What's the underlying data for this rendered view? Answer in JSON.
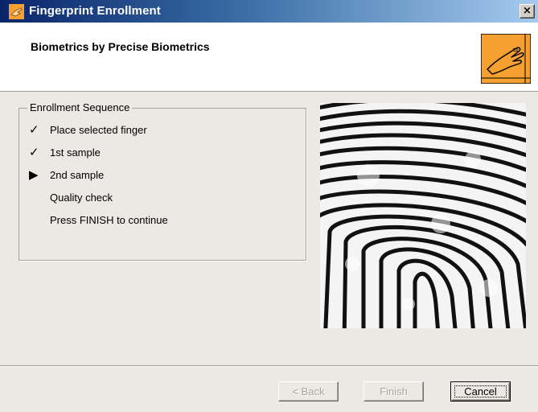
{
  "window": {
    "title": "Fingerprint Enrollment",
    "close_label": "×"
  },
  "header": {
    "title": "Biometrics by Precise Biometrics",
    "logo_icon": "hand-fingerprint-icon",
    "accent_color": "#f5a030"
  },
  "sequence": {
    "legend": "Enrollment Sequence",
    "steps": [
      {
        "label": "Place selected finger",
        "status": "done",
        "marker": "✓"
      },
      {
        "label": "1st sample",
        "status": "done",
        "marker": "✓"
      },
      {
        "label": "2nd sample",
        "status": "current",
        "marker": "▶"
      },
      {
        "label": "Quality check",
        "status": "pending",
        "marker": ""
      },
      {
        "label": "Press FINISH to continue",
        "status": "pending",
        "marker": ""
      }
    ]
  },
  "fingerprint_image": {
    "icon": "fingerprint-scan-image"
  },
  "buttons": {
    "back_label": "< Back",
    "finish_label": "Finish",
    "cancel_label": "Cancel"
  }
}
